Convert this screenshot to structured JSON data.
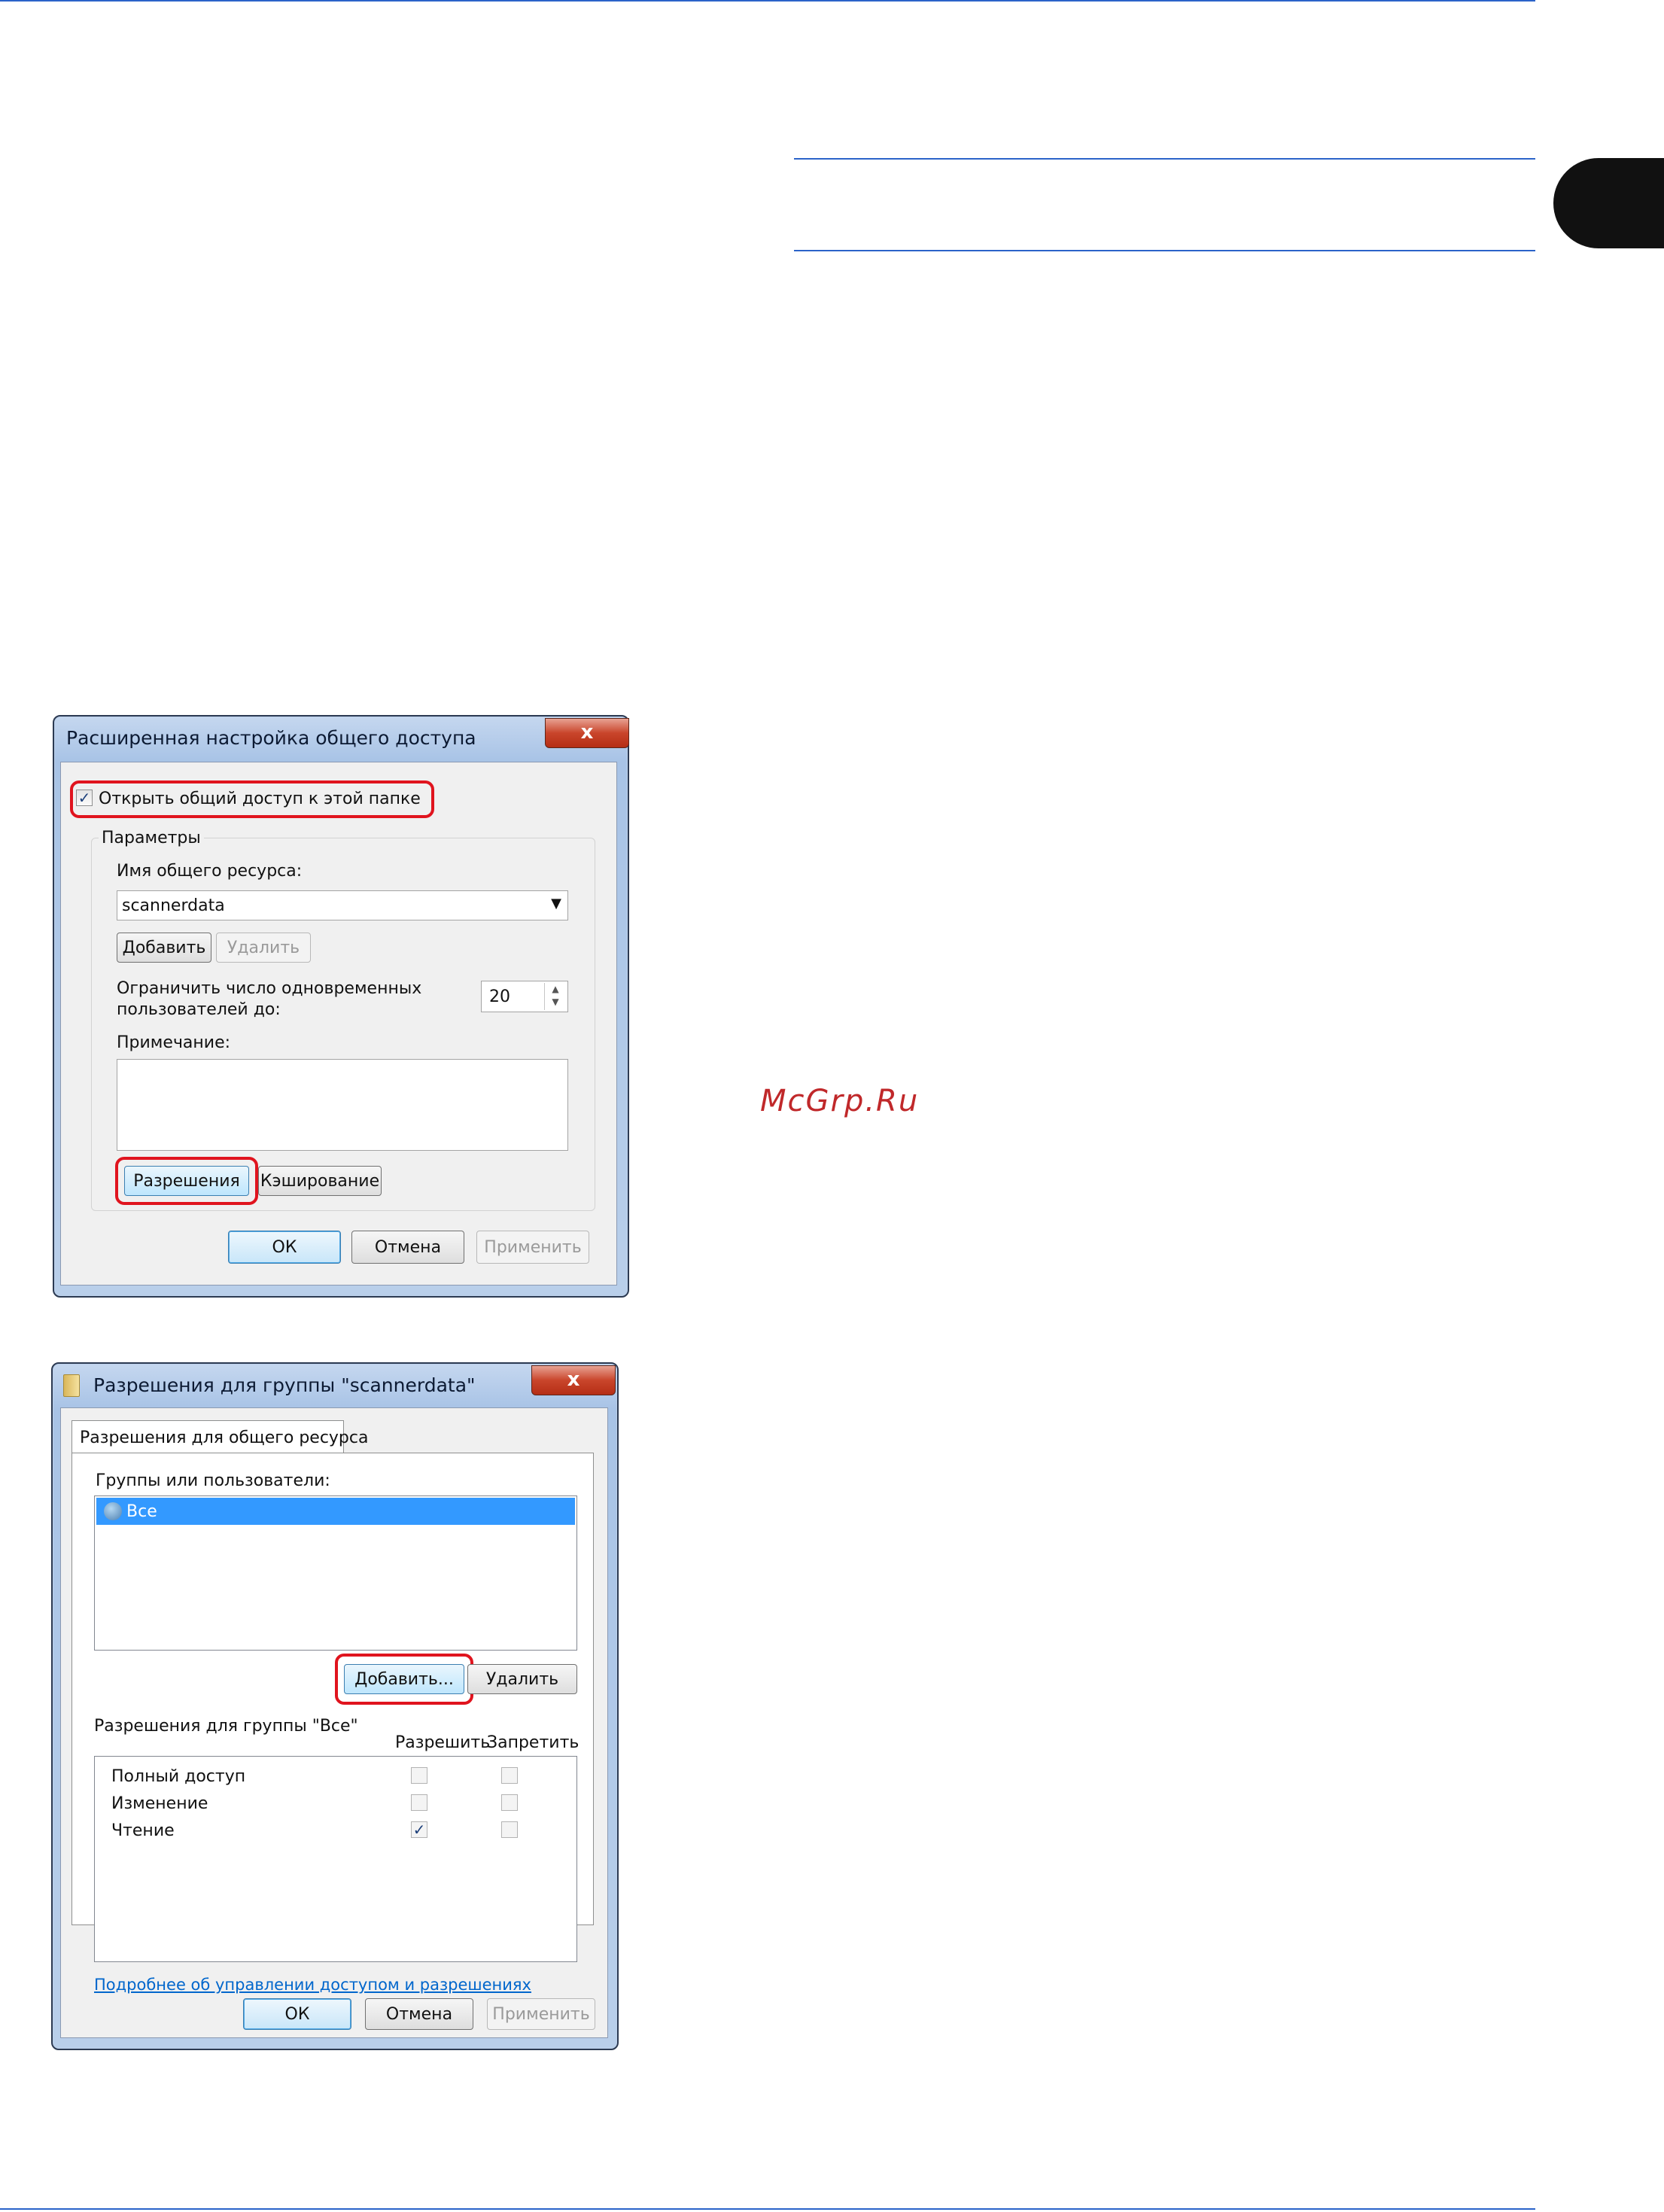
{
  "watermark": "McGrp.Ru",
  "dialog1": {
    "title": "Расширенная настройка общего доступа",
    "close_glyph": "x",
    "share_checkbox_label": "Открыть общий доступ к этой папке",
    "share_checkbox_checked": true,
    "params_group_label": "Параметры",
    "share_name_label": "Имя общего ресурса:",
    "share_name_value": "scannerdata",
    "add_label": "Добавить",
    "remove_label": "Удалить",
    "limit_label_line1": "Ограничить число одновременных",
    "limit_label_line2": "пользователей до:",
    "limit_value": "20",
    "comment_label": "Примечание:",
    "permissions_label": "Разрешения",
    "caching_label": "Кэширование",
    "ok_label": "ОК",
    "cancel_label": "Отмена",
    "apply_label": "Применить"
  },
  "dialog2": {
    "title": "Разрешения для группы \"scannerdata\"",
    "close_glyph": "x",
    "tab_label": "Разрешения для общего ресурса",
    "groups_label": "Группы или пользователи:",
    "users": [
      {
        "name": "Все",
        "selected": true
      }
    ],
    "add_label": "Добавить...",
    "remove_label": "Удалить",
    "perm_group_label": "Разрешения для группы \"Все\"",
    "allow_header": "Разрешить",
    "deny_header": "Запретить",
    "permissions": [
      {
        "name": "Полный доступ",
        "allow": false,
        "deny": false
      },
      {
        "name": "Изменение",
        "allow": false,
        "deny": false
      },
      {
        "name": "Чтение",
        "allow": true,
        "deny": false
      }
    ],
    "help_link": "Подробнее об управлении доступом и разрешениях",
    "ok_label": "ОК",
    "cancel_label": "Отмена",
    "apply_label": "Применить"
  }
}
